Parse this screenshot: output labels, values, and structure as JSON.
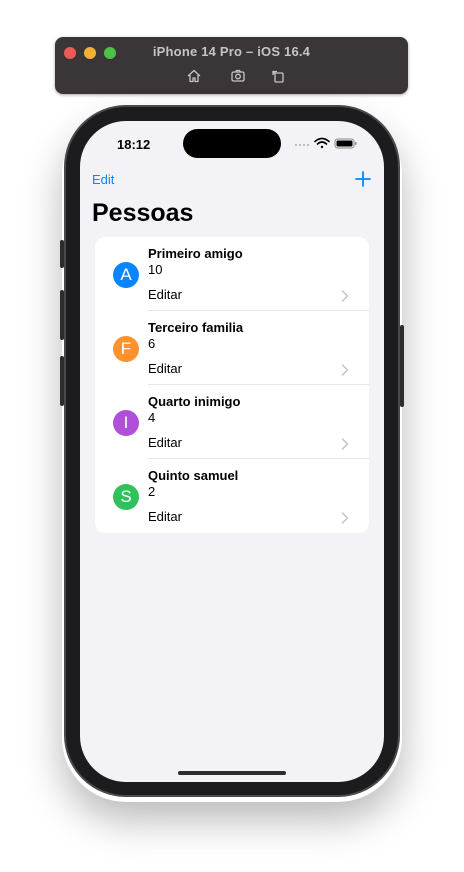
{
  "simulator": {
    "title": "iPhone 14 Pro – iOS 16.4",
    "tools": [
      "home-icon",
      "screenshot-icon",
      "rotate-icon"
    ]
  },
  "status_bar": {
    "time": "18:12"
  },
  "nav": {
    "edit_label": "Edit",
    "add_icon": "plus-icon"
  },
  "title": "Pessoas",
  "people": [
    {
      "initial": "A",
      "name": "Primeiro amigo",
      "count": "10",
      "action": "Editar",
      "color": "#0a84ff"
    },
    {
      "initial": "F",
      "name": "Terceiro familia",
      "count": "6",
      "action": "Editar",
      "color": "#ff9230"
    },
    {
      "initial": "I",
      "name": "Quarto inimigo",
      "count": "4",
      "action": "Editar",
      "color": "#b04fd8"
    },
    {
      "initial": "S",
      "name": "Quinto samuel",
      "count": "2",
      "action": "Editar",
      "color": "#30c15c"
    }
  ]
}
